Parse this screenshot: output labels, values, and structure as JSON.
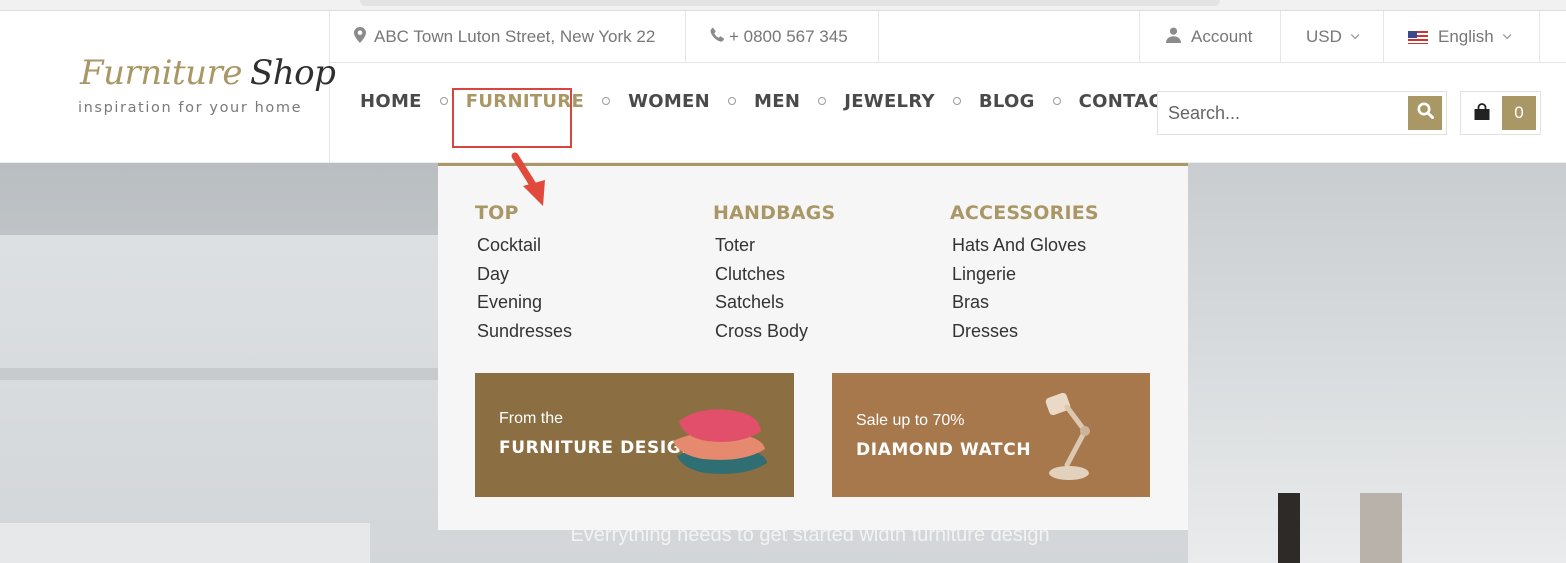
{
  "logo": {
    "word1": "Furniture",
    "word2": "Shop",
    "tagline": "inspiration for your home"
  },
  "topbar": {
    "address": "ABC Town Luton Street, New York 22",
    "phone": "+ 0800 567 345",
    "account_label": "Account",
    "currency": "USD",
    "language": "English"
  },
  "nav": {
    "items": [
      {
        "label": "HOME"
      },
      {
        "label": "FURNITURE"
      },
      {
        "label": "WOMEN"
      },
      {
        "label": "MEN"
      },
      {
        "label": "JEWELRY"
      },
      {
        "label": "BLOG"
      },
      {
        "label": "CONTACT"
      }
    ],
    "active_index": 1
  },
  "search": {
    "placeholder": "Search..."
  },
  "cart": {
    "count": "0"
  },
  "mega_menu": {
    "columns": [
      {
        "title": "TOP",
        "links": [
          "Cocktail",
          "Day",
          "Evening",
          "Sundresses"
        ]
      },
      {
        "title": "HANDBAGS",
        "links": [
          "Toter",
          "Clutches",
          "Satchels",
          "Cross Body"
        ]
      },
      {
        "title": "ACCESSORIES",
        "links": [
          "Hats And Gloves",
          "Lingerie",
          "Bras",
          "Dresses"
        ]
      }
    ],
    "banners": [
      {
        "line1": "From the",
        "line2": "FURNITURE DESIGN",
        "bg": "#8b6f43"
      },
      {
        "line1": "Sale up to 70%",
        "line2": "DIAMOND WATCH",
        "bg": "#a7784b"
      }
    ]
  },
  "hero": {
    "caption": "Everrything needs to get started width furniture design"
  },
  "colors": {
    "accent": "#a99766",
    "highlight": "#d9453c"
  }
}
